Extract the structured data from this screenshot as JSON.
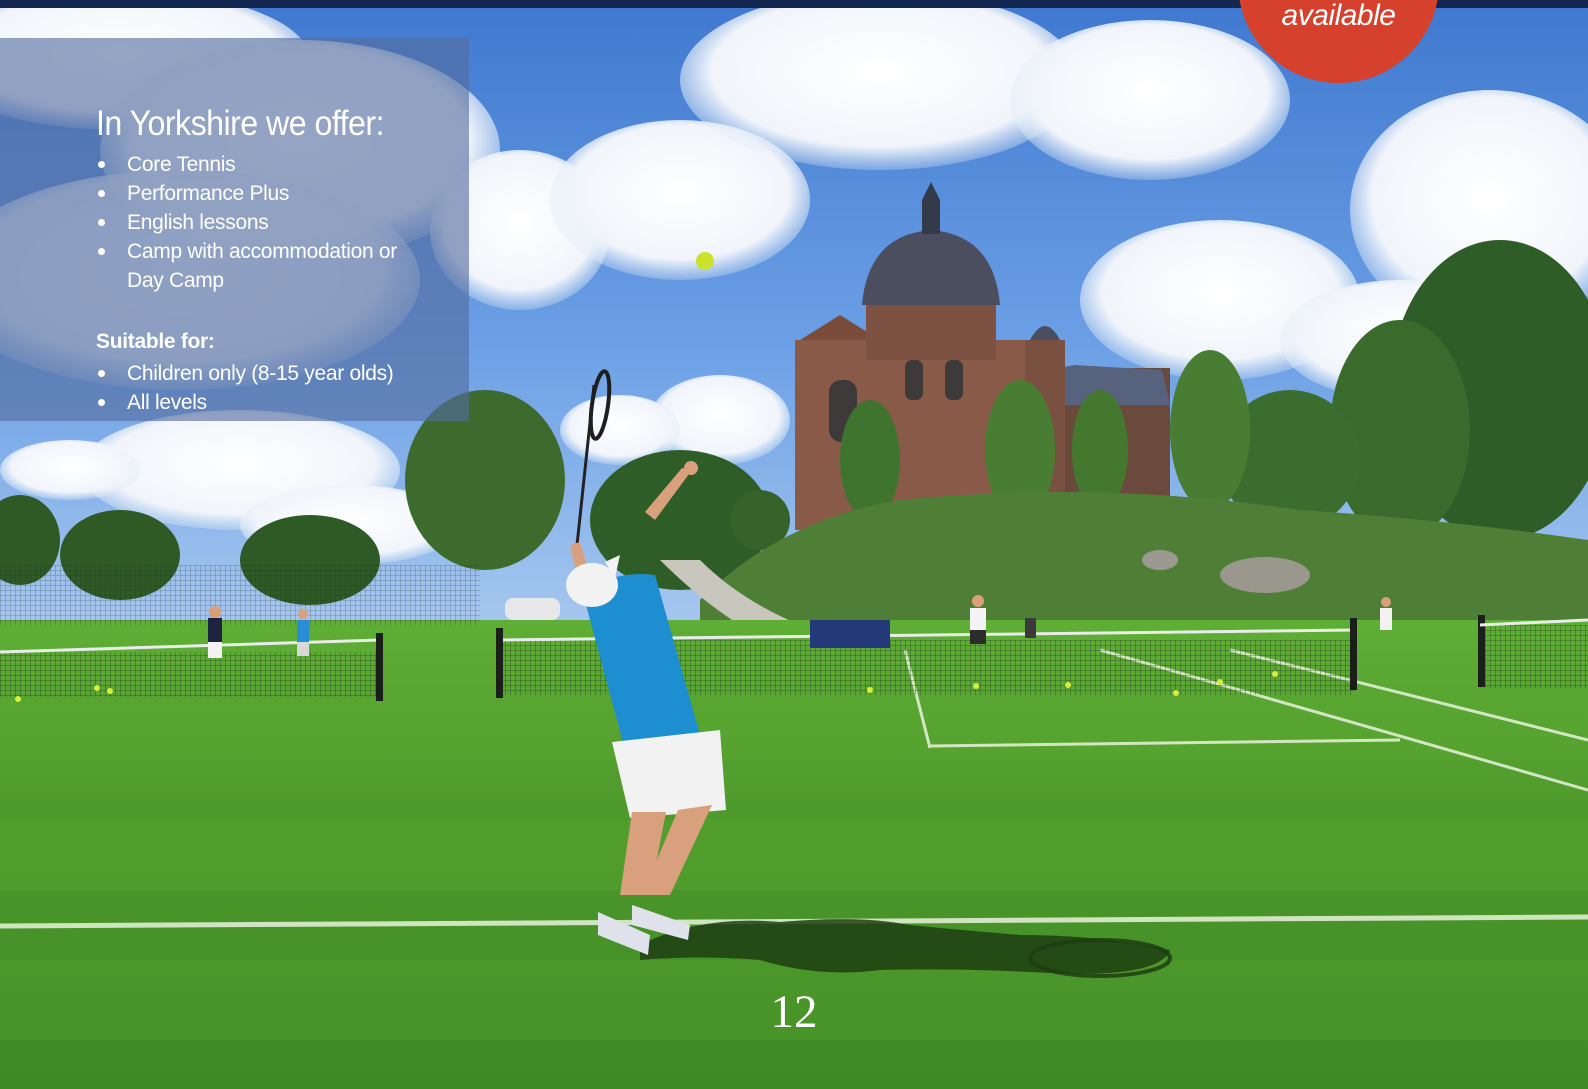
{
  "offer": {
    "title": "In Yorkshire we offer:",
    "items": [
      "Core Tennis",
      "Performance Plus",
      "English lessons",
      "Camp with accommodation or Day Camp"
    ]
  },
  "suitable": {
    "heading": "Suitable for:",
    "items": [
      "Children only (8-15 year olds)",
      "All levels"
    ]
  },
  "badge": {
    "text": "available"
  },
  "page_number": "12",
  "colors": {
    "top_bar": "#13264f",
    "badge": "#d5412c",
    "panel_overlay": "#546c9e",
    "grass": "#4f9a2c"
  }
}
